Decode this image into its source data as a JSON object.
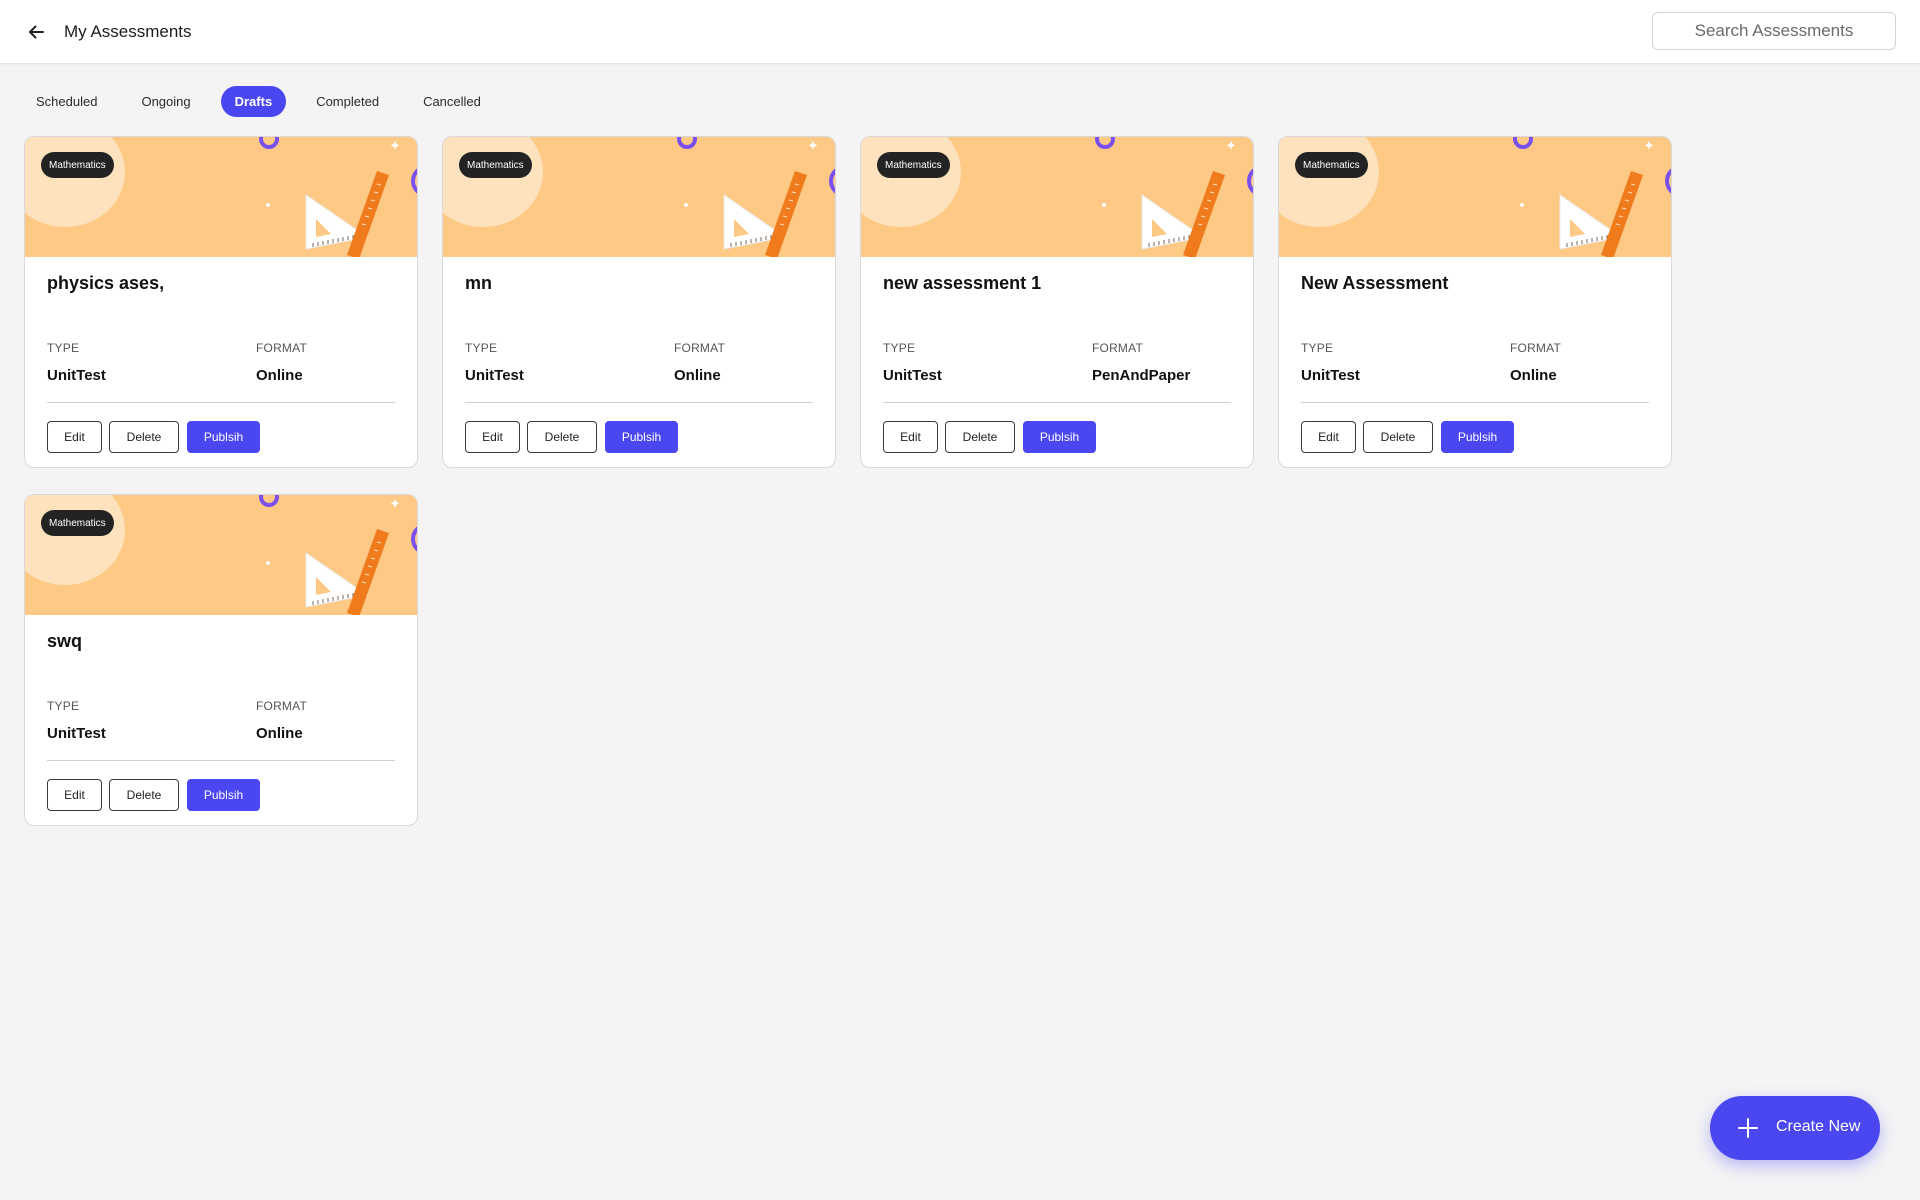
{
  "header": {
    "title": "My Assessments",
    "back_icon": "arrow-left-icon",
    "search_placeholder": "Search Assessments"
  },
  "tabs": [
    {
      "label": "Scheduled",
      "active": false
    },
    {
      "label": "Ongoing",
      "active": false
    },
    {
      "label": "Drafts",
      "active": true
    },
    {
      "label": "Completed",
      "active": false
    },
    {
      "label": "Cancelled",
      "active": false
    }
  ],
  "labels": {
    "type": "TYPE",
    "format": "FORMAT",
    "edit": "Edit",
    "delete": "Delete",
    "publish": "Publsih"
  },
  "cards": [
    {
      "subject": "Mathematics",
      "title": "physics ases,",
      "type": "UnitTest",
      "format": "Online"
    },
    {
      "subject": "Mathematics",
      "title": "mn",
      "type": "UnitTest",
      "format": "Online"
    },
    {
      "subject": "Mathematics",
      "title": "new assessment 1",
      "type": "UnitTest",
      "format": "PenAndPaper"
    },
    {
      "subject": "Mathematics",
      "title": "New Assessment",
      "type": "UnitTest",
      "format": "Online"
    },
    {
      "subject": "Mathematics",
      "title": "swq",
      "type": "UnitTest",
      "format": "Online"
    }
  ],
  "fab": {
    "label": "Create New",
    "icon": "plus-icon"
  },
  "colors": {
    "accent": "#4a46f0",
    "banner": "#fdc985",
    "badge": "#232323",
    "ruler": "#f07b1d",
    "ring": "#7a4ff0"
  }
}
